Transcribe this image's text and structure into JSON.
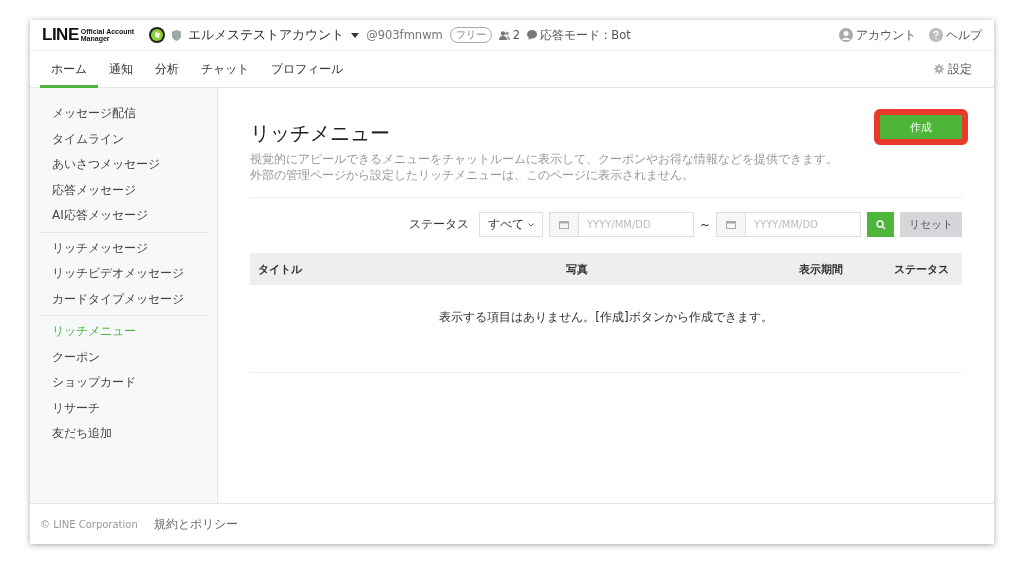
{
  "header": {
    "logo": {
      "brand": "LINE",
      "line1": "Official Account",
      "line2": "Manager"
    },
    "account_name": "エルメステストアカウント",
    "account_id": "@903fmnwm",
    "plan_badge": "フリー",
    "friends_count": "2",
    "response_mode": "応答モード : Bot",
    "account_link": "アカウント",
    "help_link": "ヘルプ"
  },
  "tabs": [
    {
      "label": "ホーム",
      "selected": true
    },
    {
      "label": "通知",
      "selected": false
    },
    {
      "label": "分析",
      "selected": false
    },
    {
      "label": "チャット",
      "selected": false
    },
    {
      "label": "プロフィール",
      "selected": false
    }
  ],
  "settings_link": "設定",
  "sidebar": {
    "groups": [
      {
        "items": [
          {
            "label": "メッセージ配信",
            "selected": false
          },
          {
            "label": "タイムライン",
            "selected": false
          },
          {
            "label": "あいさつメッセージ",
            "selected": false
          },
          {
            "label": "応答メッセージ",
            "selected": false
          },
          {
            "label": "AI応答メッセージ",
            "selected": false
          }
        ]
      },
      {
        "items": [
          {
            "label": "リッチメッセージ",
            "selected": false
          },
          {
            "label": "リッチビデオメッセージ",
            "selected": false
          },
          {
            "label": "カードタイプメッセージ",
            "selected": false
          }
        ]
      },
      {
        "items": [
          {
            "label": "リッチメニュー",
            "selected": true
          },
          {
            "label": "クーポン",
            "selected": false
          },
          {
            "label": "ショップカード",
            "selected": false
          },
          {
            "label": "リサーチ",
            "selected": false
          },
          {
            "label": "友だち追加",
            "selected": false
          }
        ]
      }
    ]
  },
  "main": {
    "title": "リッチメニュー",
    "create_button": "作成",
    "create_highlighted": true,
    "description": [
      "視覚的にアピールできるメニューをチャットルームに表示して、クーポンやお得な情報などを提供できます。",
      "外部の管理ページから設定したリッチメニューは、このページに表示されません。"
    ],
    "filter": {
      "label": "ステータス",
      "status_value": "すべて",
      "date_from_placeholder": "YYYY/MM/DD",
      "separator": "~",
      "date_to_placeholder": "YYYY/MM/DD",
      "reset_button": "リセット"
    },
    "table": {
      "columns": [
        "タイトル",
        "写真",
        "表示期間",
        "ステータス"
      ],
      "empty_message": "表示する項目はありません。[作成]ボタンから作成できます。"
    }
  },
  "footer": {
    "copyright": "© LINE Corporation",
    "terms_link": "規約とポリシー"
  }
}
